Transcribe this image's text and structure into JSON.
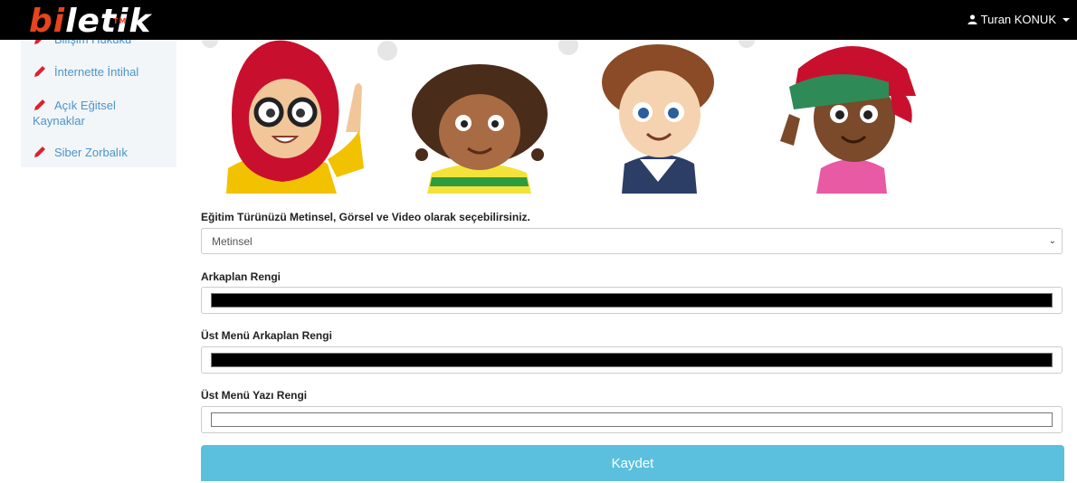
{
  "navbar": {
    "logo_prefix": "bi",
    "logo_rest": "letik",
    "logo_tm": "TM",
    "user_name": "Turan KONUK",
    "background": "#000000"
  },
  "sidebar": {
    "items": [
      {
        "label": "Bilişim Hukuku"
      },
      {
        "label": "İnternette İntihal"
      },
      {
        "label": "Açık Eğitsel Kaynaklar"
      },
      {
        "label": "Siber Zorbalık"
      }
    ],
    "icon": "pencil-icon",
    "link_color": "#4b95c7"
  },
  "form": {
    "training_type_label": "Eğitim Türünüzü Metinsel, Görsel ve Video olarak seçebilirsiniz.",
    "training_type_value": "Metinsel",
    "background_color_label": "Arkaplan Rengi",
    "background_color_value": "#000000",
    "top_menu_bg_label": "Üst Menü Arkaplan Rengi",
    "top_menu_bg_value": "#000000",
    "top_menu_text_label": "Üst Menü Yazı Rengi",
    "top_menu_text_value": "#ffffff",
    "save_label": "Kaydet",
    "save_color": "#5bc0de"
  }
}
